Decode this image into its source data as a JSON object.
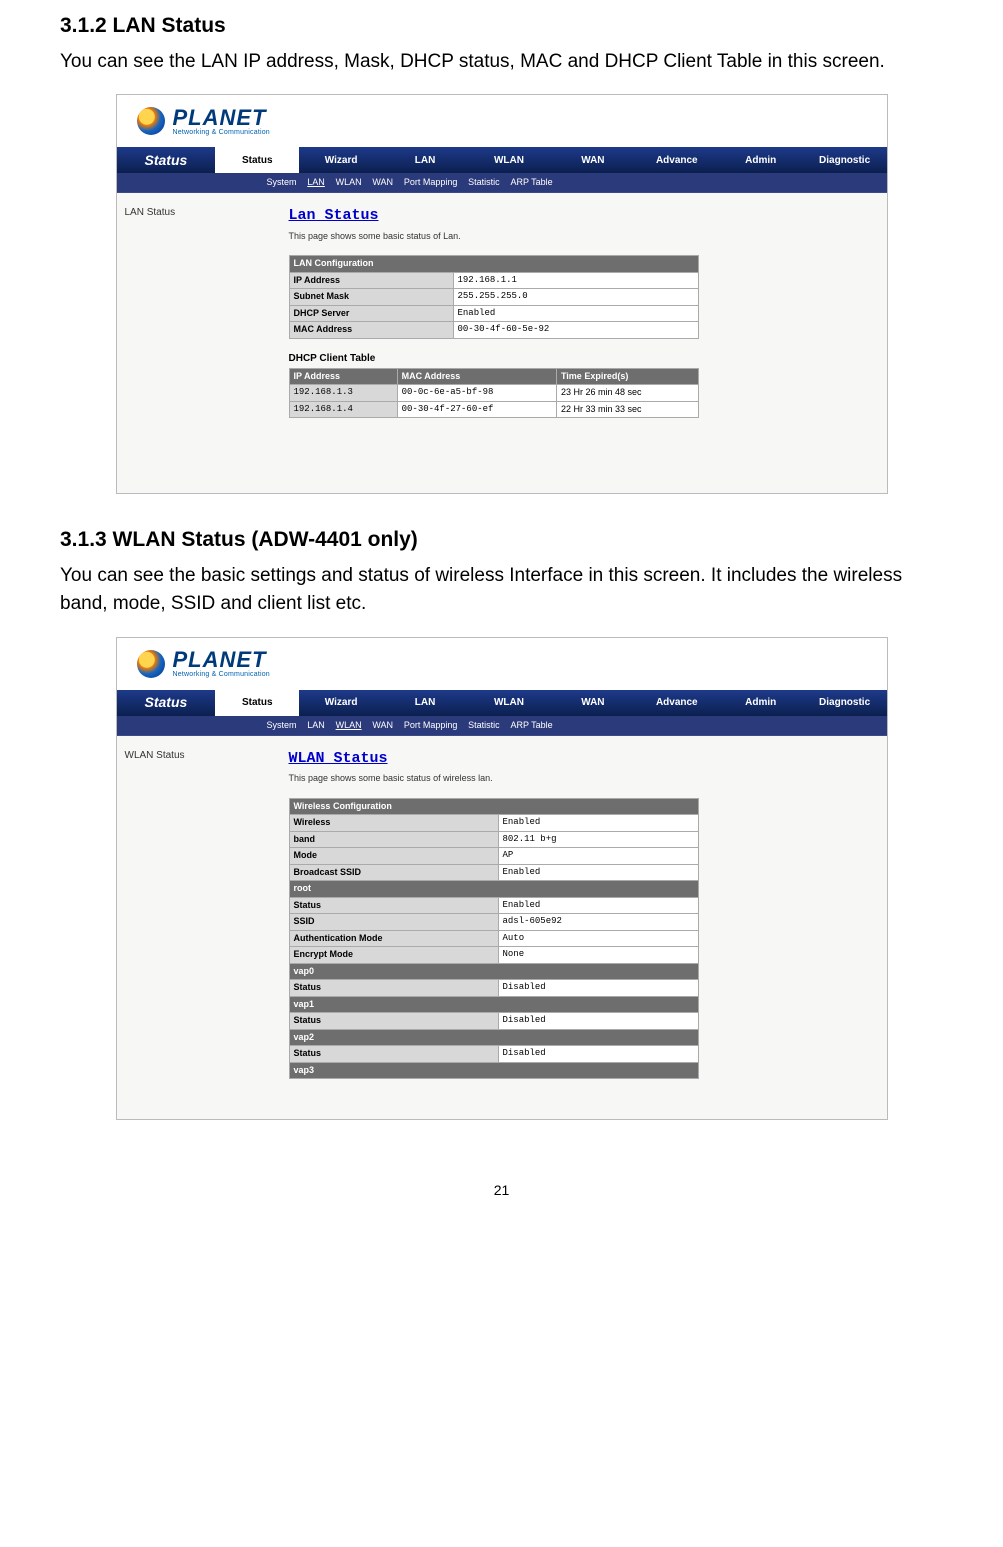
{
  "section1": {
    "heading": "3.1.2 LAN Status",
    "desc": "You can see the LAN IP address, Mask, DHCP status, MAC and DHCP Client Table in this screen."
  },
  "section2": {
    "heading": "3.1.3 WLAN Status (ADW-4401 only)",
    "desc": "You can see the basic settings and status of wireless Interface in this screen. It includes the wireless band, mode, SSID and client list etc."
  },
  "logo": {
    "main": "PLANET",
    "sub": "Networking & Communication"
  },
  "nav": {
    "title": "Status",
    "tabs": [
      "Status",
      "Wizard",
      "LAN",
      "WLAN",
      "WAN",
      "Advance",
      "Admin",
      "Diagnostic"
    ],
    "subnav": [
      "System",
      "LAN",
      "WLAN",
      "WAN",
      "Port Mapping",
      "Statistic",
      "ARP Table"
    ]
  },
  "lan": {
    "sidebar": "LAN Status",
    "title": "Lan Status",
    "subtitle": "This page shows some basic status of Lan.",
    "cfg_header": "LAN Configuration",
    "rows": [
      {
        "label": "IP Address",
        "val": "192.168.1.1"
      },
      {
        "label": "Subnet Mask",
        "val": "255.255.255.0"
      },
      {
        "label": "DHCP Server",
        "val": "Enabled"
      },
      {
        "label": "MAC Address",
        "val": "00-30-4f-60-5e-92"
      }
    ],
    "dhcp_title": "DHCP Client Table",
    "dhcp_headers": [
      "IP Address",
      "MAC Address",
      "Time Expired(s)"
    ],
    "dhcp_rows": [
      {
        "ip": "192.168.1.3",
        "mac": "00-0c-6e-a5-bf-98",
        "time": "23 Hr 26 min 48 sec"
      },
      {
        "ip": "192.168.1.4",
        "mac": "00-30-4f-27-60-ef",
        "time": "22 Hr 33 min 33 sec"
      }
    ]
  },
  "wlan": {
    "sidebar": "WLAN Status",
    "title": "WLAN Status",
    "subtitle": "This page shows some basic status of wireless lan.",
    "cfg_header": "Wireless Configuration",
    "rows": [
      {
        "label": "Wireless",
        "val": "Enabled"
      },
      {
        "label": "band",
        "val": "802.11 b+g"
      },
      {
        "label": "Mode",
        "val": "AP"
      },
      {
        "label": "Broadcast SSID",
        "val": "Enabled"
      }
    ],
    "groups": [
      {
        "name": "root",
        "rows": [
          {
            "label": "Status",
            "val": "Enabled"
          },
          {
            "label": "SSID",
            "val": "adsl-605e92"
          },
          {
            "label": "Authentication Mode",
            "val": "Auto"
          },
          {
            "label": "Encrypt Mode",
            "val": "None"
          }
        ]
      },
      {
        "name": "vap0",
        "rows": [
          {
            "label": "Status",
            "val": "Disabled"
          }
        ]
      },
      {
        "name": "vap1",
        "rows": [
          {
            "label": "Status",
            "val": "Disabled"
          }
        ]
      },
      {
        "name": "vap2",
        "rows": [
          {
            "label": "Status",
            "val": "Disabled"
          }
        ]
      },
      {
        "name": "vap3",
        "rows": []
      }
    ]
  },
  "page_number": "21"
}
